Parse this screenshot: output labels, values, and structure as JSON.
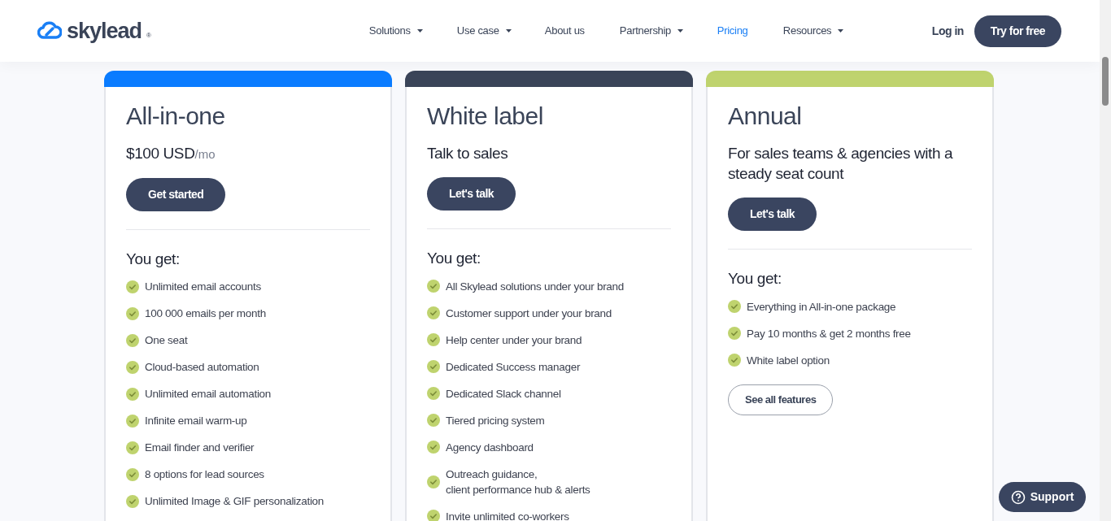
{
  "header": {
    "logo": {
      "text": "skylead",
      "mark": "®"
    },
    "nav": [
      {
        "label": "Solutions",
        "dropdown": true,
        "selected": false
      },
      {
        "label": "Use case",
        "dropdown": true,
        "selected": false
      },
      {
        "label": "About us",
        "dropdown": false,
        "selected": false
      },
      {
        "label": "Partnership",
        "dropdown": true,
        "selected": false
      },
      {
        "label": "Pricing",
        "dropdown": false,
        "selected": true
      },
      {
        "label": "Resources",
        "dropdown": true,
        "selected": false
      }
    ],
    "login": "Log in",
    "cta": "Try for free"
  },
  "plans": [
    {
      "name": "All-in-one",
      "color": "#0a7cff",
      "tagline": "$100 USD",
      "unit": "/mo",
      "cta": "Get started",
      "features_heading": "You get:",
      "features": [
        "Unlimited email accounts",
        "100 000 emails per month",
        "One seat",
        "Cloud-based automation",
        "Unlimited email automation",
        "Infinite email warm-up",
        "Email finder and verifier",
        "8 options for lead sources",
        "Unlimited Image & GIF personalization"
      ]
    },
    {
      "name": "White label",
      "color": "#3a4458",
      "tagline": "Talk to sales",
      "cta": "Let's talk",
      "features_heading": "You get:",
      "features": [
        "All Skylead solutions under your brand",
        "Customer support under your brand",
        "Help center under your brand",
        "Dedicated Success manager",
        "Dedicated Slack channel",
        "Tiered pricing system",
        "Agency dashboard",
        "Outreach guidance,\nclient performance hub & alerts",
        "Invite unlimited co-workers"
      ]
    },
    {
      "name": "Annual",
      "color": "#bfd36e",
      "tagline": "For sales teams & agencies with a steady seat count",
      "cta": "Let's talk",
      "features_heading": "You get:",
      "features": [
        "Everything in All-in-one package",
        "Pay 10 months & get 2 months free",
        "White label option"
      ],
      "secondary": "See all features"
    }
  ],
  "support_button": "Support"
}
